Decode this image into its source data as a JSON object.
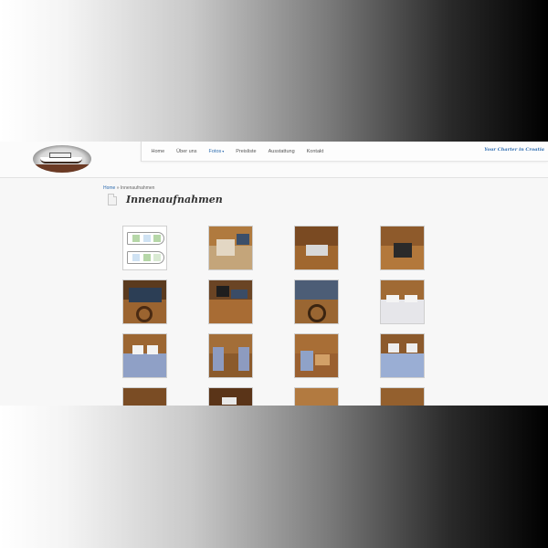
{
  "nav": {
    "items": [
      {
        "label": "Home",
        "active": false,
        "dropdown": false
      },
      {
        "label": "Über uns",
        "active": false,
        "dropdown": false
      },
      {
        "label": "Fotos",
        "active": true,
        "dropdown": true
      },
      {
        "label": "Preisliste",
        "active": false,
        "dropdown": false
      },
      {
        "label": "Ausstattung",
        "active": false,
        "dropdown": false
      },
      {
        "label": "Kontakt",
        "active": false,
        "dropdown": false
      }
    ],
    "caret": "▾",
    "tagline": "Your Charter in Croatia"
  },
  "breadcrumb": {
    "home": "Home",
    "separator": " » ",
    "current": "Innenaufnahmen"
  },
  "page": {
    "title": "Innenaufnahmen"
  },
  "colors": {
    "accent": "#2f6db0",
    "page_bg": "#f7f7f7",
    "wood": "#8a5a2a"
  },
  "gallery": {
    "thumbnails": [
      {
        "kind": "floor-plan"
      },
      {
        "kind": "photo"
      },
      {
        "kind": "photo"
      },
      {
        "kind": "photo"
      },
      {
        "kind": "photo"
      },
      {
        "kind": "photo"
      },
      {
        "kind": "photo"
      },
      {
        "kind": "photo"
      },
      {
        "kind": "photo"
      },
      {
        "kind": "photo"
      },
      {
        "kind": "photo"
      },
      {
        "kind": "photo"
      },
      {
        "kind": "photo"
      },
      {
        "kind": "photo"
      },
      {
        "kind": "photo"
      },
      {
        "kind": "photo"
      }
    ]
  }
}
